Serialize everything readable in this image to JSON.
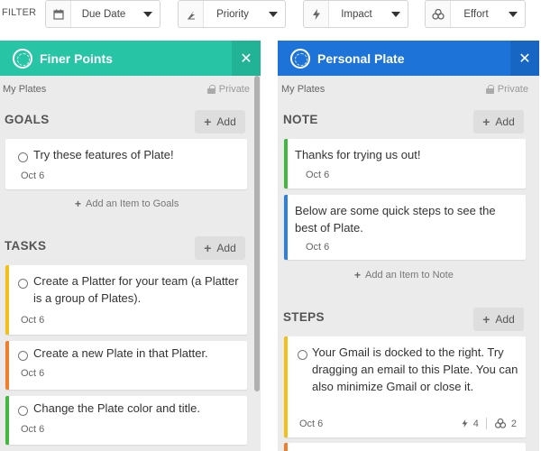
{
  "filter": {
    "label": "FILTER",
    "buttons": [
      {
        "label": "Due Date",
        "icon": "calendar-icon"
      },
      {
        "label": "Priority",
        "icon": "priority-icon"
      },
      {
        "label": "Impact",
        "icon": "lightning-icon"
      },
      {
        "label": "Effort",
        "icon": "effort-icon"
      }
    ]
  },
  "plates": [
    {
      "title": "Finer Points",
      "color": "#28c4a6",
      "owner_label": "My Plates",
      "privacy": "Private",
      "sections": [
        {
          "title": "GOALS",
          "add_label": "Add",
          "add_item_label": "Add an Item to Goals",
          "cards": [
            {
              "text": "Try these features of Plate!",
              "date": "Oct 6"
            }
          ]
        },
        {
          "title": "TASKS",
          "add_label": "Add",
          "cards": [
            {
              "text": "Create a Platter for your team (a Platter is a group of Plates).",
              "date": "Oct 6",
              "color": "#f2c018"
            },
            {
              "text": "Create a new Plate in that Platter.",
              "date": "Oct 6",
              "color": "#ef7f2a"
            },
            {
              "text": "Change the Plate color and title.",
              "date": "Oct 6",
              "color": "#41b941"
            }
          ]
        }
      ]
    },
    {
      "title": "Personal Plate",
      "color": "#1d73d8",
      "owner_label": "My Plates",
      "privacy": "Private",
      "sections": [
        {
          "title": "NOTE",
          "add_label": "Add",
          "add_item_label": "Add an Item to Note",
          "cards": [
            {
              "text": "Thanks for trying us out!",
              "date": "Oct 6",
              "color": "#41b941"
            },
            {
              "text": "Below are some quick steps to see the best of Plate.",
              "date": "Oct 6",
              "color": "#2f7fdc"
            }
          ]
        },
        {
          "title": "STEPS",
          "add_label": "Add",
          "cards": [
            {
              "text": "Your Gmail is docked to the right. Try dragging an email to this Plate. You can also minimize Gmail or close it.",
              "date": "Oct 6",
              "color": "#f2c018",
              "impact": "4",
              "effort": "2"
            }
          ]
        }
      ]
    }
  ]
}
